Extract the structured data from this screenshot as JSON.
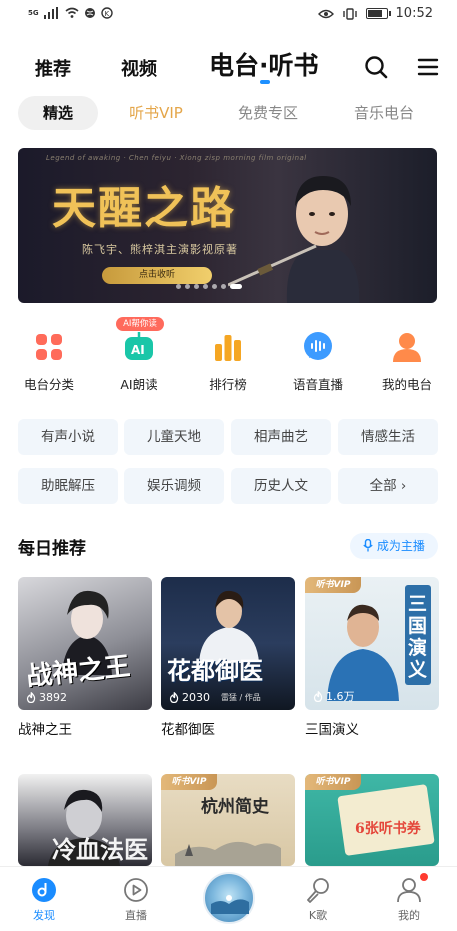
{
  "status_bar": {
    "network": "5G",
    "time": "10:52",
    "battery_level": 0.85
  },
  "top_nav": {
    "tabs": [
      "推荐",
      "视频",
      "电台·听书"
    ],
    "active_tab": "电台·听书",
    "accent": "#1e90ff"
  },
  "segments": [
    "精选",
    "听书VIP",
    "免费专区",
    "音乐电台"
  ],
  "banner": {
    "top_line": "Legend of awaking · Chen feiyu · Xiong zisp morning film original",
    "title": "天醒之路",
    "cast_line": "陈飞宇、熊梓淇主演影视原著",
    "button": "点击收听",
    "slide_count": 7,
    "active_slide": 7
  },
  "quick_icons": [
    {
      "label": "电台分类",
      "icon": "grid-icon",
      "color": "#ff6b5a"
    },
    {
      "label": "AI朗读",
      "icon": "ai-robot-icon",
      "color": "#1ac6a8"
    },
    {
      "label": "排行榜",
      "icon": "bar-chart-icon",
      "color": "#f5a623"
    },
    {
      "label": "语音直播",
      "icon": "voice-bubble-icon",
      "color": "#3d9bff"
    },
    {
      "label": "我的电台",
      "icon": "user-icon",
      "color": "#ff8a4a"
    }
  ],
  "ai_badge": "AI帮你读",
  "categories": [
    "有声小说",
    "儿童天地",
    "相声曲艺",
    "情感生活",
    "助眠解压",
    "娱乐调频",
    "历史人文",
    "全部 ›"
  ],
  "daily": {
    "title": "每日推荐",
    "host_button": "成为主播",
    "cards": [
      {
        "name": "战神之王",
        "cover_text": "战神之王",
        "plays": "3892",
        "vip": false
      },
      {
        "name": "花都御医",
        "cover_text": "花都御医",
        "plays": "2030",
        "author": "雷猛 / 作品",
        "vip": false
      },
      {
        "name": "三国演义",
        "cover_text": "三国演义",
        "plays": "1.6万",
        "vip": true
      }
    ],
    "more_cards": [
      {
        "cover_text": "冷血法医",
        "vip": false
      },
      {
        "cover_text": "杭州简史",
        "vip": true
      },
      {
        "cover_text": "6张听书券",
        "vip": true
      }
    ],
    "vip_tag": "听书VIP"
  },
  "bottom_nav": [
    "发现",
    "直播",
    "",
    "K歌",
    "我的"
  ],
  "bottom_active": "发现"
}
